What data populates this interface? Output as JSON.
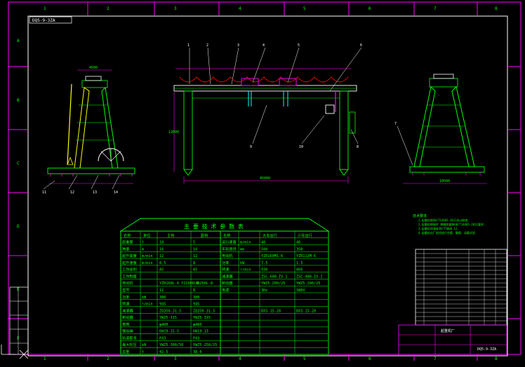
{
  "sheet": {
    "drawing_id": "DQ5-9-3ZA",
    "columns": [
      "1",
      "2",
      "3",
      "4",
      "5",
      "6",
      "7",
      "8"
    ],
    "rows": [
      "A",
      "B",
      "C",
      "D",
      "E",
      "F"
    ]
  },
  "front_view": {
    "top_dim": "4500",
    "callouts": [
      "11",
      "12",
      "13",
      "14"
    ]
  },
  "main_view": {
    "span_dim": "45000",
    "height_dim": "12000",
    "callouts_top": [
      "1",
      "2",
      "3",
      "4",
      "5",
      "6"
    ],
    "callouts_mid": [
      "10",
      "9",
      "8"
    ]
  },
  "side_view": {
    "base_dim": "10500",
    "callout": "7"
  },
  "table": {
    "title": "主 要 技 术 参 数 表",
    "left_rows": [
      [
        "起重量",
        "t",
        "10",
        "5"
      ],
      [
        "跨度",
        "m",
        "16",
        "16"
      ],
      [
        "起升高度",
        "m/min",
        "12",
        "12"
      ],
      [
        "起升速度",
        "m/min",
        "8.5",
        "8"
      ],
      [
        "工作级别",
        "",
        "A5",
        "A5"
      ],
      [
        "工作制度",
        "",
        "",
        ""
      ],
      [
        "电动机",
        "",
        "YZR160L-6 YZ200L-8",
        "YZR200L-8"
      ],
      [
        "型号",
        "",
        "12",
        "8"
      ],
      [
        "功率",
        "kW",
        "380",
        "380"
      ],
      [
        "转速",
        "r/min",
        "945",
        "945"
      ],
      [
        "减速器",
        "",
        "ZQ350-31.5",
        "ZQ350-31.5"
      ],
      [
        "制动器",
        "",
        "YWZ5-315",
        "YWZ5-315"
      ],
      [
        "卷筒",
        "",
        "φ400",
        "φ400"
      ],
      [
        "钢丝绳",
        "",
        "6W19-15.5",
        "6W19-13"
      ],
      [
        "轨道型号",
        "",
        "P43",
        "P43"
      ],
      [
        "最大轮压",
        "kN",
        "YWZ5-300/50",
        "YWZ5-250/25"
      ],
      [
        "总重",
        "t",
        "42.5",
        "38.0"
      ]
    ],
    "left_head": [
      "名称",
      "单位",
      "主钩",
      "副钩"
    ],
    "right_head": [
      "名称",
      "大车运行",
      "小车运行"
    ],
    "right_rows": [
      [
        "运行速度",
        "m/min",
        "40",
        "40"
      ],
      [
        "车轮直径",
        "mm",
        "500",
        "350"
      ],
      [
        "电动机",
        "",
        "YZR160M1-6",
        "YZR112M-6"
      ],
      [
        "功率",
        "kW",
        "7.5",
        "1.5"
      ],
      [
        "转速",
        "r/min",
        "930",
        "866"
      ],
      [
        "减速器",
        "",
        "ZSC-600-IV-1",
        "ZSC-400-IV-1"
      ],
      [
        "制动器",
        "",
        "YWZ5-200/25",
        "YWZ5-200/25"
      ],
      [
        "电源",
        "",
        "3Hz",
        "380V"
      ],
      [
        "",
        "",
        "",
        ""
      ]
    ],
    "bottom_notes": [
      "BX3-15-20",
      "BX3-15-20"
    ]
  },
  "notes": {
    "title": "技术要求",
    "lines": [
      "1.起重机按GB/T14405-2011设计制造.",
      "2.起重机焊接件 焊缝质量按GB/T14405-2011要求.",
      "3.起重机涂漆按JB/T5000.12.",
      "4.起重机出厂前须进行空载、静载、动载试验."
    ]
  },
  "title_block": {
    "drawing_no": "DQ5-9-3ZA",
    "company": "起重机厂"
  }
}
